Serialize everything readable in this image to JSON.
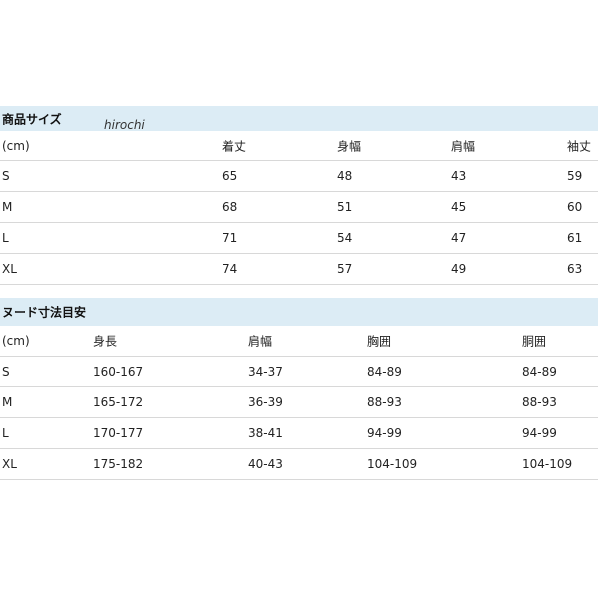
{
  "watermark": "hirochi",
  "product_size": {
    "title": "商品サイズ",
    "headers": [
      "(cm)",
      "着丈",
      "身幅",
      "肩幅",
      "袖丈"
    ],
    "rows": [
      [
        "S",
        "65",
        "48",
        "43",
        "59"
      ],
      [
        "M",
        "68",
        "51",
        "45",
        "60"
      ],
      [
        "L",
        "71",
        "54",
        "47",
        "61"
      ],
      [
        "XL",
        "74",
        "57",
        "49",
        "63"
      ]
    ]
  },
  "nude_size": {
    "title": "ヌード寸法目安",
    "headers": [
      "(cm)",
      "身長",
      "肩幅",
      "胸囲",
      "胴囲"
    ],
    "rows": [
      [
        "S",
        "160-167",
        "34-37",
        "84-89",
        "84-89"
      ],
      [
        "M",
        "165-172",
        "36-39",
        "88-93",
        "88-93"
      ],
      [
        "L",
        "170-177",
        "38-41",
        "94-99",
        "94-99"
      ],
      [
        "XL",
        "175-182",
        "40-43",
        "104-109",
        "104-109"
      ]
    ]
  }
}
